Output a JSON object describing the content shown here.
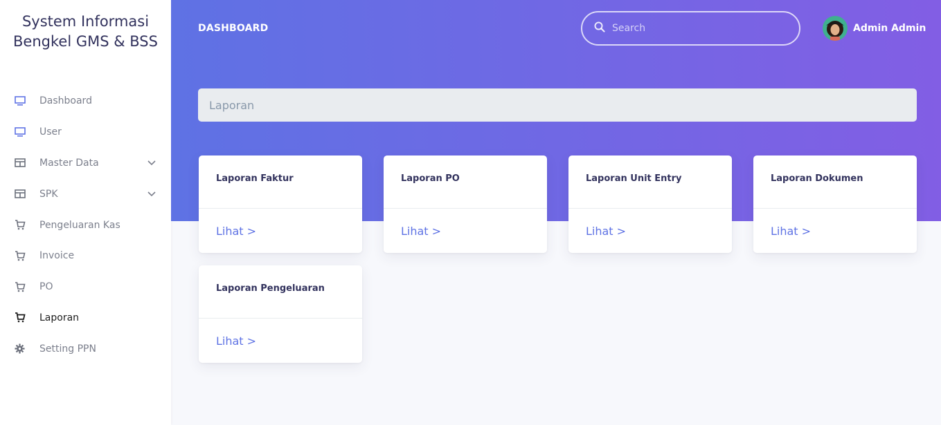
{
  "brand": {
    "line1": "System Informasi",
    "line2": "Bengkel GMS & BSS"
  },
  "sidebar": {
    "items": [
      {
        "label": "Dashboard",
        "icon": "monitor-icon"
      },
      {
        "label": "User",
        "icon": "monitor-icon"
      },
      {
        "label": "Master Data",
        "icon": "table-icon",
        "expandable": true
      },
      {
        "label": "SPK",
        "icon": "table-icon",
        "expandable": true
      },
      {
        "label": "Pengeluaran Kas",
        "icon": "cart-icon"
      },
      {
        "label": "Invoice",
        "icon": "cart-icon"
      },
      {
        "label": "PO",
        "icon": "cart-icon"
      },
      {
        "label": "Laporan",
        "icon": "cart-icon",
        "active": true
      },
      {
        "label": "Setting PPN",
        "icon": "gear-icon"
      }
    ]
  },
  "header": {
    "title": "DASHBOARD",
    "search_placeholder": "Search",
    "user_name": "Admin Admin"
  },
  "breadcrumb": {
    "label": "Laporan"
  },
  "cards": [
    {
      "title": "Laporan Faktur",
      "link": "Lihat >"
    },
    {
      "title": "Laporan PO",
      "link": "Lihat >"
    },
    {
      "title": "Laporan Unit Entry",
      "link": "Lihat >"
    },
    {
      "title": "Laporan Dokumen",
      "link": "Lihat >"
    },
    {
      "title": "Laporan Pengeluaran",
      "link": "Lihat >"
    }
  ],
  "colors": {
    "accent": "#5e72e4",
    "gradient_start": "#5e72e4",
    "gradient_end": "#825ee4"
  }
}
